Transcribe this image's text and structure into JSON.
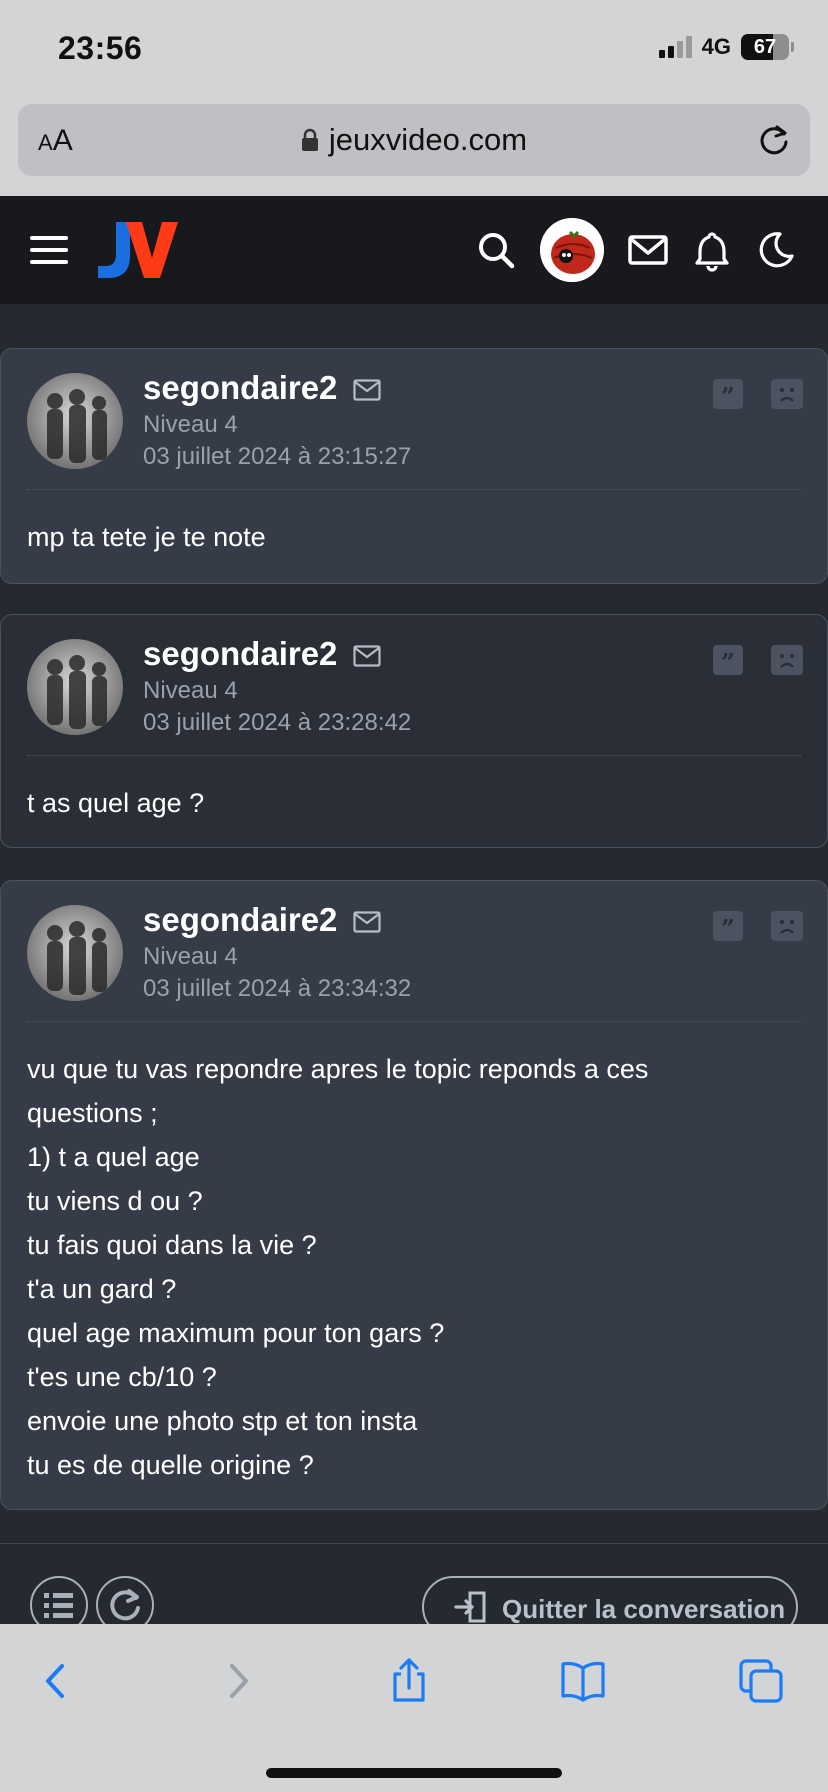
{
  "status_bar": {
    "time": "23:56",
    "network": "4G",
    "battery": "67",
    "battery_level": 0.67
  },
  "browser": {
    "text_size_label": "AA",
    "url": "jeuxvideo.com"
  },
  "site": {
    "logo": "JV",
    "colors": {
      "logo_blue": "#1a6fe0",
      "logo_red": "#ff3a16",
      "header_bg": "#17191d",
      "page_bg": "#252a31"
    }
  },
  "messages": [
    {
      "author": "segondaire2",
      "level": "Niveau 4",
      "date": "03 juillet 2024 à 23:15:27",
      "lines": [
        "mp ta tete je te note"
      ]
    },
    {
      "author": "segondaire2",
      "level": "Niveau 4",
      "date": "03 juillet 2024 à 23:28:42",
      "lines": [
        "t as quel age ?"
      ]
    },
    {
      "author": "segondaire2",
      "level": "Niveau 4",
      "date": "03 juillet 2024 à 23:34:32",
      "lines": [
        "vu que tu vas repondre apres le topic reponds a ces",
        "questions ;",
        "1) t a quel age",
        "tu viens d ou ?",
        "tu fais quoi dans la vie ?",
        "t'a un gard ?",
        "quel age maximum pour ton gars ?",
        "t'es une cb/10 ?",
        "envoie une photo stp et ton insta",
        "tu es de quelle origine ?"
      ]
    }
  ],
  "actions": {
    "quit_label": "Quitter la conversation"
  },
  "icons": [
    "hamburger-icon",
    "search-icon",
    "mail-icon",
    "bell-icon",
    "moon-icon",
    "quote-icon",
    "sad-face-icon",
    "list-icon",
    "refresh-icon",
    "exit-door-icon",
    "back-icon",
    "forward-icon",
    "share-icon",
    "bookmarks-icon",
    "tabs-icon"
  ]
}
